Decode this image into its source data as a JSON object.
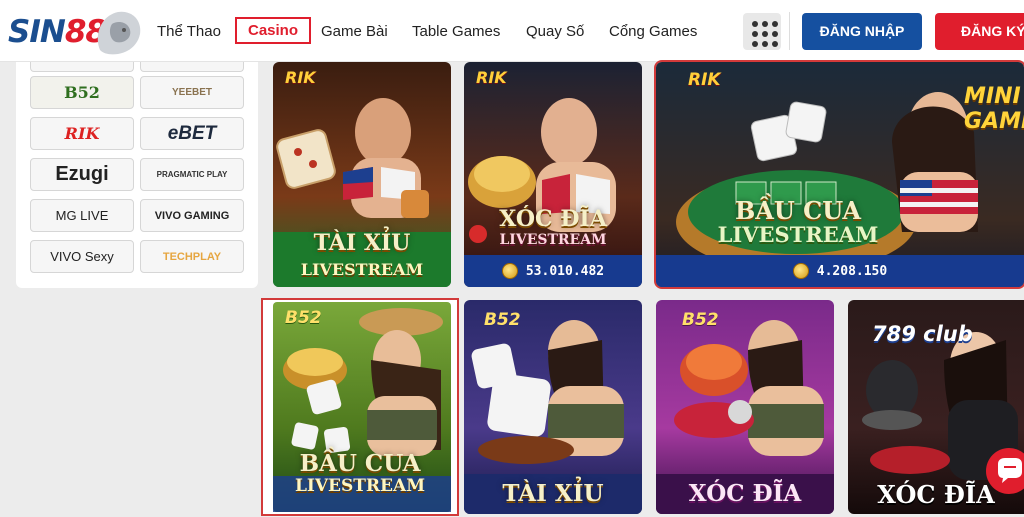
{
  "header": {
    "logo": {
      "part1": "SIN",
      "part2": "88"
    },
    "nav": [
      {
        "label": "Thể Thao",
        "active": false
      },
      {
        "label": "Casino",
        "active": true
      },
      {
        "label": "Game Bài",
        "active": false
      },
      {
        "label": "Table Games",
        "active": false
      },
      {
        "label": "Quay Số",
        "active": false
      },
      {
        "label": "Cổng Games",
        "active": false
      }
    ],
    "menu_icon": "grid-dots-icon",
    "login_label": "ĐĂNG NHẬP",
    "register_label": "ĐĂNG KÝ"
  },
  "sidebar": {
    "providers": [
      {
        "label": "B52"
      },
      {
        "label": "YEEBET"
      },
      {
        "label": "RIK"
      },
      {
        "label": "eBET"
      },
      {
        "label": "Ezugi"
      },
      {
        "label": "PRAGMATIC PLAY"
      },
      {
        "label": "MG LIVE"
      },
      {
        "label": "VIVO GAMING"
      },
      {
        "label": "VIVO Sexy"
      },
      {
        "label": "TECHPLAY"
      }
    ]
  },
  "games": [
    {
      "brand": "RIK",
      "title": "TÀI XỈU",
      "subtitle": "LIVESTREAM",
      "jackpot": ""
    },
    {
      "brand": "RIK",
      "title": "XÓC ĐĨA",
      "subtitle": "LIVESTREAM",
      "jackpot": "53.010.482"
    },
    {
      "brand": "RIK",
      "title": "BẦU CUA",
      "subtitle": "LIVESTREAM",
      "badge": "MINI GAME",
      "jackpot": "4.208.150"
    },
    {
      "brand": "B52",
      "title": "BẦU CUA",
      "subtitle": "LIVESTREAM",
      "jackpot": ""
    },
    {
      "brand": "B52",
      "title": "TÀI XỈU",
      "subtitle": "",
      "jackpot": ""
    },
    {
      "brand": "B52",
      "title": "XÓC ĐĨA",
      "subtitle": "",
      "jackpot": ""
    },
    {
      "brand": "789 club",
      "title": "XÓC ĐĨA",
      "subtitle": "",
      "jackpot": ""
    }
  ],
  "chat_icon": "chat-bubble-icon",
  "colors": {
    "brand_blue": "#1550a0",
    "brand_red": "#e01e2d",
    "jackpot_bar": "#173a8f"
  }
}
